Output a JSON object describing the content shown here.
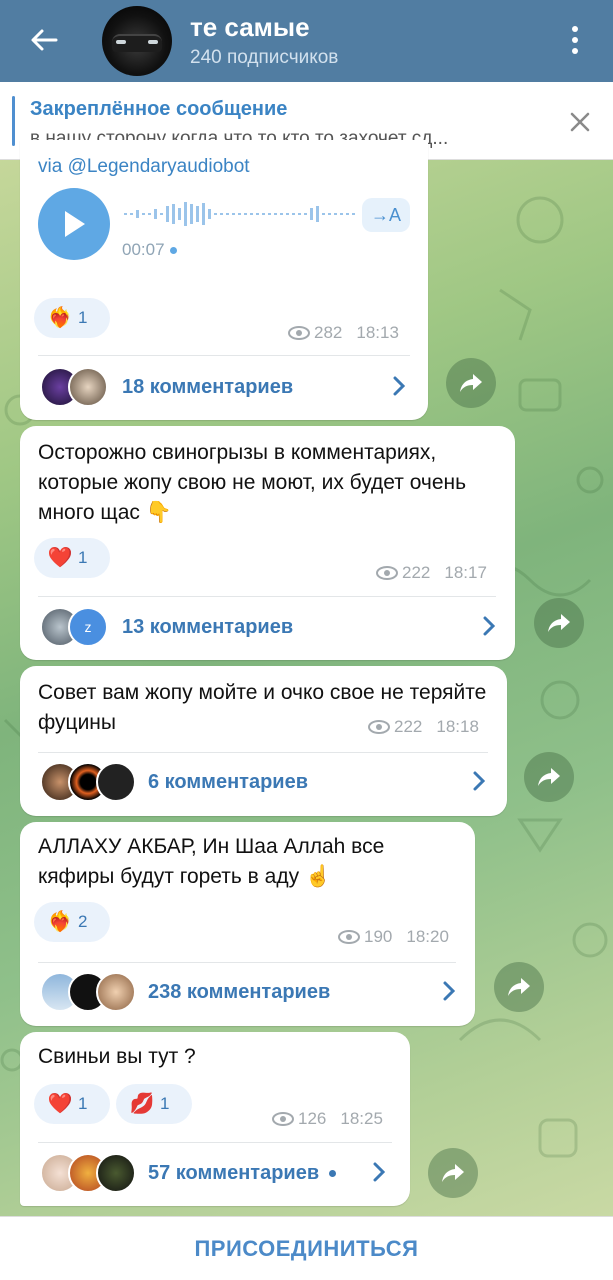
{
  "header": {
    "title": "те самые",
    "subtitle": "240 подписчиков"
  },
  "pinned": {
    "title": "Закреплённое сообщение",
    "text": "в нашу сторону когда что то кто то захочет сд..."
  },
  "voice_message": {
    "via": "via @Legendaryaudiobot",
    "duration": "00:07",
    "transcribe_label": "→A",
    "reaction": {
      "emoji": "❤️‍🔥",
      "count": "1"
    },
    "views": "282",
    "time": "18:13",
    "comments": "18 комментариев"
  },
  "messages": [
    {
      "text": "Осторожно свиногрызы в комментариях, которые жопу свою не моют, их будет очень много щас 👇",
      "reactions": [
        {
          "emoji": "❤️",
          "count": "1"
        }
      ],
      "views": "222",
      "time": "18:17",
      "comments": "13 комментариев"
    },
    {
      "text": "Совет вам жопу мойте и очко свое не теряйте фуцины",
      "views": "222",
      "time": "18:18",
      "comments": "6 комментариев"
    },
    {
      "text": "АЛЛАХУ АКБАР, Ин Шаа Аллаһ все кяфиры будут гореть в аду ☝️",
      "reactions": [
        {
          "emoji": "❤️‍🔥",
          "count": "2"
        }
      ],
      "views": "190",
      "time": "18:20",
      "comments": "238 комментариев"
    },
    {
      "text": "Свиньи вы тут ?",
      "reactions": [
        {
          "emoji": "❤️",
          "count": "1"
        },
        {
          "emoji": "💋",
          "count": "1"
        }
      ],
      "views": "126",
      "time": "18:25",
      "comments": "57 комментариев"
    }
  ],
  "join_label": "ПРИСОЕДИНИТЬСЯ",
  "colors": {
    "header": "#517da2",
    "accent": "#3b78b4",
    "bubble": "#ffffff"
  }
}
